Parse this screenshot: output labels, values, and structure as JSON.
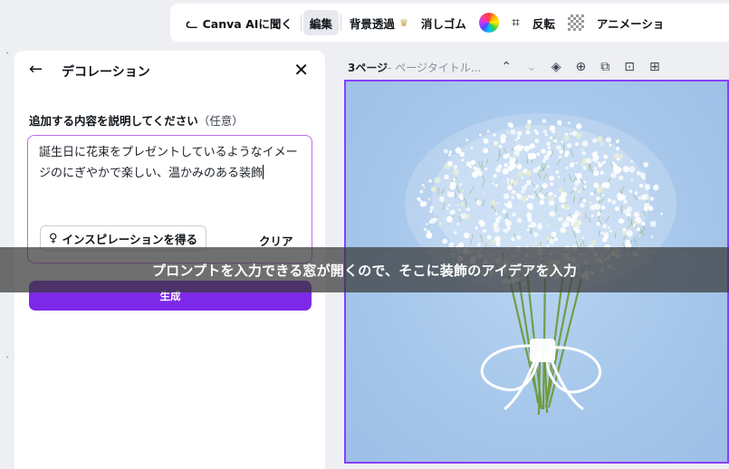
{
  "toolbar": {
    "ai_label": "Canva AIに聞く",
    "edit_label": "編集",
    "bg_remove_label": "背景透過",
    "eraser_label": "消しゴム",
    "flip_label": "反転",
    "animate_label": "アニメーショ"
  },
  "panel": {
    "title": "デコレーション",
    "prompt_label": "追加する内容を説明してください",
    "prompt_optional": "（任意）",
    "prompt_value": "誕生日に花束をプレゼントしているようなイメージのにぎやかで楽しい、温かみのある装飾",
    "inspire_label": "インスピレーションを得る",
    "clear_label": "クリア",
    "generate_label": "生成"
  },
  "page": {
    "label": "3ページ",
    "title_placeholder": " - ページタイトル..."
  },
  "caption": "プロンプトを入力できる窓が開くので、そこに装飾のアイデアを入力",
  "colors": {
    "accent": "#7d2ae8",
    "canvas_border": "#8b3dff",
    "prompt_border": "#b66cf0",
    "photo_bg": "#aacbee"
  },
  "icons": [
    "canva-ai-icon",
    "crown-icon",
    "color-wheel-icon",
    "crop-icon",
    "transparency-icon",
    "back-arrow-icon",
    "close-icon",
    "bulb-icon",
    "chevron-up-icon",
    "chevron-down-icon",
    "hide-icon",
    "lock-icon",
    "duplicate-icon",
    "delete-icon",
    "add-page-icon"
  ]
}
